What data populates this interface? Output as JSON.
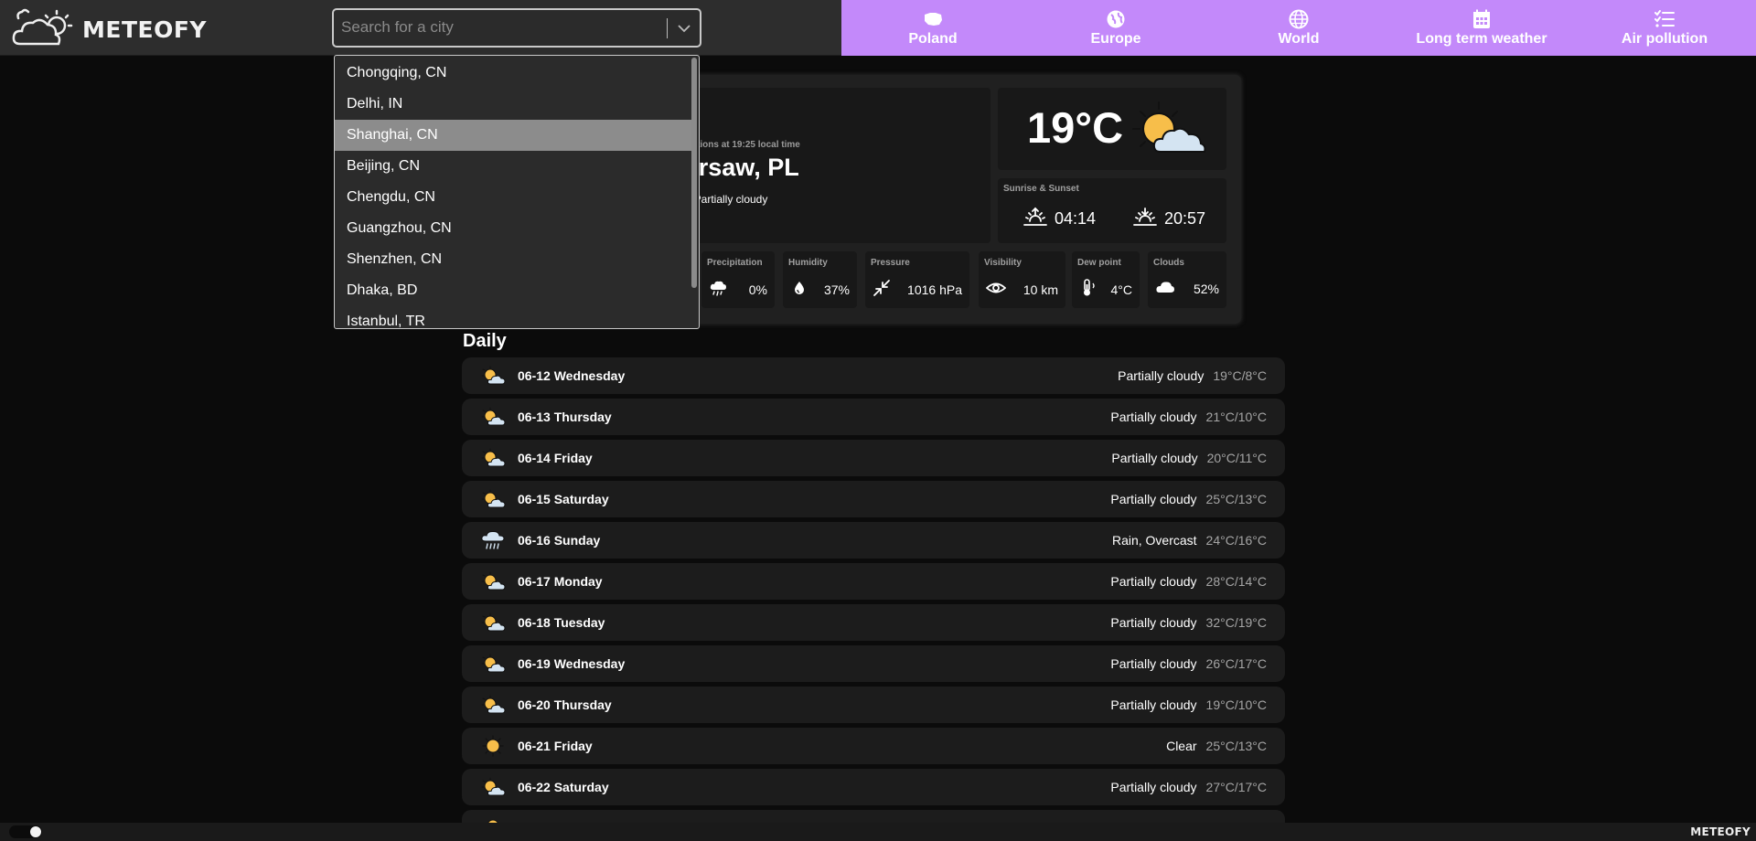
{
  "brand": {
    "name": "METEOFY"
  },
  "search": {
    "placeholder": "Search for a city"
  },
  "nav": [
    {
      "label": "Poland",
      "icon": "poland-map-icon"
    },
    {
      "label": "Europe",
      "icon": "globe-europe-icon"
    },
    {
      "label": "World",
      "icon": "globe-icon"
    },
    {
      "label": "Long term weather",
      "icon": "calendar-icon"
    },
    {
      "label": "Air pollution",
      "icon": "checklist-icon"
    }
  ],
  "dropdown": {
    "items": [
      "Chongqing, CN",
      "Delhi, IN",
      "Shanghai, CN",
      "Beijing, CN",
      "Chengdu, CN",
      "Guangzhou, CN",
      "Shenzhen, CN",
      "Dhaka, BD",
      "Istanbul, TR"
    ],
    "selected_index": 2
  },
  "current": {
    "conditions_at": "er conditions at 19:25 local time",
    "city": "Warsaw, PL",
    "description": "Partially cloudy",
    "temperature": "19°C",
    "sunrise_sunset_title": "Sunrise & Sunset",
    "sunrise": "04:14",
    "sunset": "20:57"
  },
  "stats": [
    {
      "title": "Precipitation",
      "value": "0%",
      "icon": "rain-cloud-icon"
    },
    {
      "title": "Humidity",
      "value": "37%",
      "icon": "droplet-icon"
    },
    {
      "title": "Pressure",
      "value": "1016 hPa",
      "icon": "compress-arrows-icon"
    },
    {
      "title": "Visibility",
      "value": "10 km",
      "icon": "eye-icon"
    },
    {
      "title": "Dew point",
      "value": "4°C",
      "icon": "thermometer-icon"
    },
    {
      "title": "Clouds",
      "value": "52%",
      "icon": "cloud-icon"
    }
  ],
  "daily": {
    "title": "Daily",
    "days": [
      {
        "date": "06-12 Wednesday",
        "condition": "Partially cloudy",
        "range": "19°C/8°C",
        "icon": "partly-cloudy-icon"
      },
      {
        "date": "06-13 Thursday",
        "condition": "Partially cloudy",
        "range": "21°C/10°C",
        "icon": "partly-cloudy-icon"
      },
      {
        "date": "06-14 Friday",
        "condition": "Partially cloudy",
        "range": "20°C/11°C",
        "icon": "partly-cloudy-icon"
      },
      {
        "date": "06-15 Saturday",
        "condition": "Partially cloudy",
        "range": "25°C/13°C",
        "icon": "partly-cloudy-icon"
      },
      {
        "date": "06-16 Sunday",
        "condition": "Rain, Overcast",
        "range": "24°C/16°C",
        "icon": "rain-icon"
      },
      {
        "date": "06-17 Monday",
        "condition": "Partially cloudy",
        "range": "28°C/14°C",
        "icon": "partly-cloudy-icon"
      },
      {
        "date": "06-18 Tuesday",
        "condition": "Partially cloudy",
        "range": "32°C/19°C",
        "icon": "partly-cloudy-icon"
      },
      {
        "date": "06-19 Wednesday",
        "condition": "Partially cloudy",
        "range": "26°C/17°C",
        "icon": "partly-cloudy-icon"
      },
      {
        "date": "06-20 Thursday",
        "condition": "Partially cloudy",
        "range": "19°C/10°C",
        "icon": "partly-cloudy-icon"
      },
      {
        "date": "06-21 Friday",
        "condition": "Clear",
        "range": "25°C/13°C",
        "icon": "sun-icon"
      },
      {
        "date": "06-22 Saturday",
        "condition": "Partially cloudy",
        "range": "27°C/17°C",
        "icon": "partly-cloudy-icon"
      }
    ]
  },
  "footer": {
    "brand": "METEOFY"
  },
  "colors": {
    "accent": "#c389fa",
    "background": "#0b0b0b",
    "card": "#202020",
    "panel": "#181818",
    "selected": "#8c8c8c"
  }
}
